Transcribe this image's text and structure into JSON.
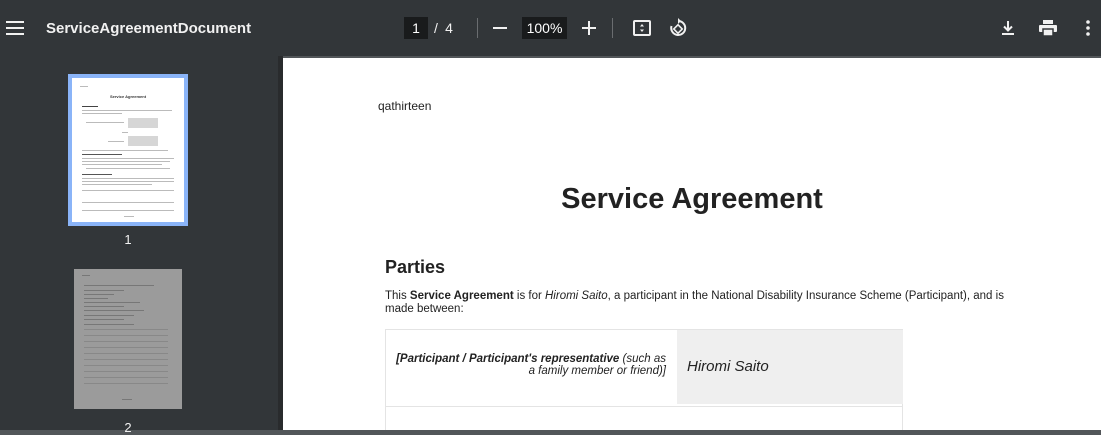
{
  "toolbar": {
    "menu_icon": "hamburger-menu-icon",
    "title": "ServiceAgreementDocument",
    "current_page": "1",
    "page_separator": "/",
    "total_pages": "4",
    "zoom_level": "100%",
    "icons": {
      "zoom_out": "minus-icon",
      "zoom_in": "plus-icon",
      "fit": "fit-to-page-icon",
      "rotate": "rotate-icon",
      "download": "download-icon",
      "print": "print-icon",
      "more": "more-vertical-icon"
    }
  },
  "sidebar": {
    "thumbnails": [
      {
        "number": "1",
        "selected": true
      },
      {
        "number": "2",
        "selected": false
      }
    ],
    "thumbnail_1_title": "Service Agreement"
  },
  "document": {
    "header_text": "qathirteen",
    "title": "Service Agreement",
    "section_heading": "Parties",
    "intro": {
      "part1": "This ",
      "bold": "Service Agreement",
      "part2": " is for ",
      "italic_name": "Hiromi Saito",
      "part3": ", a participant in the National Disability Insurance Scheme (Participant), and is made between:"
    },
    "table": {
      "row1_label_bold": "[Participant / Participant's representative",
      "row1_label_rest": " (such as a family member or friend)]",
      "row1_value": "Hiromi Saito"
    }
  },
  "colors": {
    "toolbar_bg": "#323639",
    "viewer_bg": "#525659",
    "thumb_selected_border": "#8ab4f8"
  }
}
